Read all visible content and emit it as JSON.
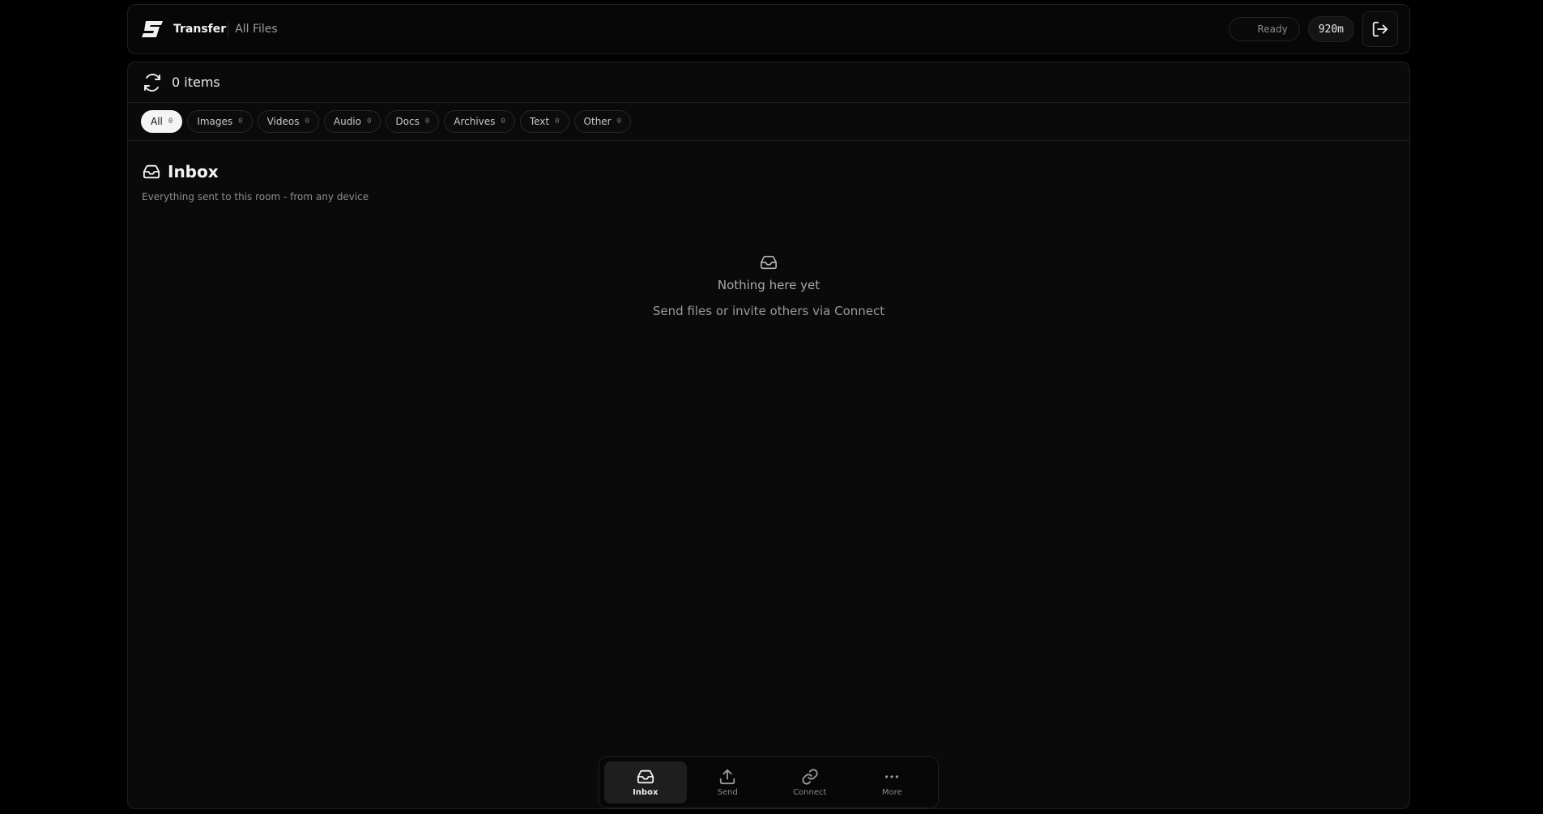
{
  "header": {
    "brand_name": "Transfer",
    "section": "All Files",
    "status": "Ready",
    "timer": "920m"
  },
  "main": {
    "items_count": "0 items",
    "filters": [
      {
        "label": "All",
        "count": "0",
        "active": true
      },
      {
        "label": "Images",
        "count": "0"
      },
      {
        "label": "Videos",
        "count": "0"
      },
      {
        "label": "Audio",
        "count": "0"
      },
      {
        "label": "Docs",
        "count": "0"
      },
      {
        "label": "Archives",
        "count": "0"
      },
      {
        "label": "Text",
        "count": "0"
      },
      {
        "label": "Other",
        "count": "0"
      }
    ],
    "inbox_title": "Inbox",
    "inbox_subtitle": "Everything sent to this room - from any device",
    "empty_title": "Nothing here yet",
    "empty_subtitle": "Send files or invite others via Connect"
  },
  "nav": {
    "items": [
      {
        "label": "Inbox",
        "icon": "inbox-icon",
        "active": true
      },
      {
        "label": "Send",
        "icon": "upload-icon"
      },
      {
        "label": "Connect",
        "icon": "link-icon"
      },
      {
        "label": "More",
        "icon": "more-icon"
      }
    ]
  }
}
